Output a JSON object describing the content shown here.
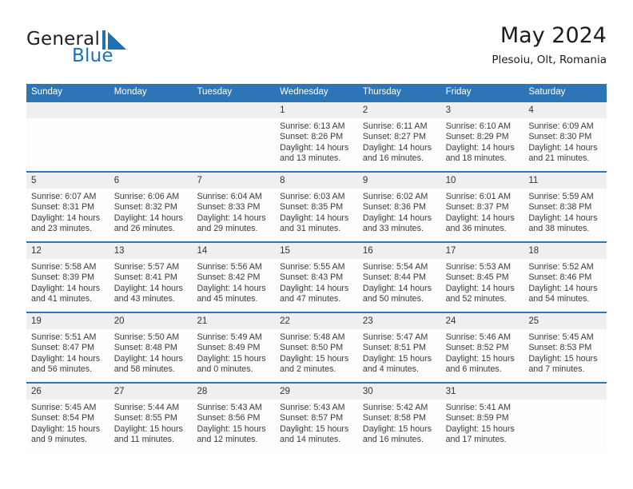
{
  "brand": {
    "word1": "General",
    "word2": "Blue",
    "mark_icon": "triangle-flag-icon",
    "color_text": "#231f20",
    "color_blue": "#1d71b8"
  },
  "header": {
    "title": "May 2024",
    "location": "Plesoiu, Olt, Romania"
  },
  "calendar": {
    "accent_color": "#2e75b6",
    "daynum_band_color": "#efefef",
    "weekday_headers": [
      "Sunday",
      "Monday",
      "Tuesday",
      "Wednesday",
      "Thursday",
      "Friday",
      "Saturday"
    ],
    "weeks": [
      [
        {
          "day": "",
          "lines": []
        },
        {
          "day": "",
          "lines": []
        },
        {
          "day": "",
          "lines": []
        },
        {
          "day": "1",
          "lines": [
            "Sunrise: 6:13 AM",
            "Sunset: 8:26 PM",
            "Daylight: 14 hours",
            "and 13 minutes."
          ]
        },
        {
          "day": "2",
          "lines": [
            "Sunrise: 6:11 AM",
            "Sunset: 8:27 PM",
            "Daylight: 14 hours",
            "and 16 minutes."
          ]
        },
        {
          "day": "3",
          "lines": [
            "Sunrise: 6:10 AM",
            "Sunset: 8:29 PM",
            "Daylight: 14 hours",
            "and 18 minutes."
          ]
        },
        {
          "day": "4",
          "lines": [
            "Sunrise: 6:09 AM",
            "Sunset: 8:30 PM",
            "Daylight: 14 hours",
            "and 21 minutes."
          ]
        }
      ],
      [
        {
          "day": "5",
          "lines": [
            "Sunrise: 6:07 AM",
            "Sunset: 8:31 PM",
            "Daylight: 14 hours",
            "and 23 minutes."
          ]
        },
        {
          "day": "6",
          "lines": [
            "Sunrise: 6:06 AM",
            "Sunset: 8:32 PM",
            "Daylight: 14 hours",
            "and 26 minutes."
          ]
        },
        {
          "day": "7",
          "lines": [
            "Sunrise: 6:04 AM",
            "Sunset: 8:33 PM",
            "Daylight: 14 hours",
            "and 29 minutes."
          ]
        },
        {
          "day": "8",
          "lines": [
            "Sunrise: 6:03 AM",
            "Sunset: 8:35 PM",
            "Daylight: 14 hours",
            "and 31 minutes."
          ]
        },
        {
          "day": "9",
          "lines": [
            "Sunrise: 6:02 AM",
            "Sunset: 8:36 PM",
            "Daylight: 14 hours",
            "and 33 minutes."
          ]
        },
        {
          "day": "10",
          "lines": [
            "Sunrise: 6:01 AM",
            "Sunset: 8:37 PM",
            "Daylight: 14 hours",
            "and 36 minutes."
          ]
        },
        {
          "day": "11",
          "lines": [
            "Sunrise: 5:59 AM",
            "Sunset: 8:38 PM",
            "Daylight: 14 hours",
            "and 38 minutes."
          ]
        }
      ],
      [
        {
          "day": "12",
          "lines": [
            "Sunrise: 5:58 AM",
            "Sunset: 8:39 PM",
            "Daylight: 14 hours",
            "and 41 minutes."
          ]
        },
        {
          "day": "13",
          "lines": [
            "Sunrise: 5:57 AM",
            "Sunset: 8:41 PM",
            "Daylight: 14 hours",
            "and 43 minutes."
          ]
        },
        {
          "day": "14",
          "lines": [
            "Sunrise: 5:56 AM",
            "Sunset: 8:42 PM",
            "Daylight: 14 hours",
            "and 45 minutes."
          ]
        },
        {
          "day": "15",
          "lines": [
            "Sunrise: 5:55 AM",
            "Sunset: 8:43 PM",
            "Daylight: 14 hours",
            "and 47 minutes."
          ]
        },
        {
          "day": "16",
          "lines": [
            "Sunrise: 5:54 AM",
            "Sunset: 8:44 PM",
            "Daylight: 14 hours",
            "and 50 minutes."
          ]
        },
        {
          "day": "17",
          "lines": [
            "Sunrise: 5:53 AM",
            "Sunset: 8:45 PM",
            "Daylight: 14 hours",
            "and 52 minutes."
          ]
        },
        {
          "day": "18",
          "lines": [
            "Sunrise: 5:52 AM",
            "Sunset: 8:46 PM",
            "Daylight: 14 hours",
            "and 54 minutes."
          ]
        }
      ],
      [
        {
          "day": "19",
          "lines": [
            "Sunrise: 5:51 AM",
            "Sunset: 8:47 PM",
            "Daylight: 14 hours",
            "and 56 minutes."
          ]
        },
        {
          "day": "20",
          "lines": [
            "Sunrise: 5:50 AM",
            "Sunset: 8:48 PM",
            "Daylight: 14 hours",
            "and 58 minutes."
          ]
        },
        {
          "day": "21",
          "lines": [
            "Sunrise: 5:49 AM",
            "Sunset: 8:49 PM",
            "Daylight: 15 hours",
            "and 0 minutes."
          ]
        },
        {
          "day": "22",
          "lines": [
            "Sunrise: 5:48 AM",
            "Sunset: 8:50 PM",
            "Daylight: 15 hours",
            "and 2 minutes."
          ]
        },
        {
          "day": "23",
          "lines": [
            "Sunrise: 5:47 AM",
            "Sunset: 8:51 PM",
            "Daylight: 15 hours",
            "and 4 minutes."
          ]
        },
        {
          "day": "24",
          "lines": [
            "Sunrise: 5:46 AM",
            "Sunset: 8:52 PM",
            "Daylight: 15 hours",
            "and 6 minutes."
          ]
        },
        {
          "day": "25",
          "lines": [
            "Sunrise: 5:45 AM",
            "Sunset: 8:53 PM",
            "Daylight: 15 hours",
            "and 7 minutes."
          ]
        }
      ],
      [
        {
          "day": "26",
          "lines": [
            "Sunrise: 5:45 AM",
            "Sunset: 8:54 PM",
            "Daylight: 15 hours",
            "and 9 minutes."
          ]
        },
        {
          "day": "27",
          "lines": [
            "Sunrise: 5:44 AM",
            "Sunset: 8:55 PM",
            "Daylight: 15 hours",
            "and 11 minutes."
          ]
        },
        {
          "day": "28",
          "lines": [
            "Sunrise: 5:43 AM",
            "Sunset: 8:56 PM",
            "Daylight: 15 hours",
            "and 12 minutes."
          ]
        },
        {
          "day": "29",
          "lines": [
            "Sunrise: 5:43 AM",
            "Sunset: 8:57 PM",
            "Daylight: 15 hours",
            "and 14 minutes."
          ]
        },
        {
          "day": "30",
          "lines": [
            "Sunrise: 5:42 AM",
            "Sunset: 8:58 PM",
            "Daylight: 15 hours",
            "and 16 minutes."
          ]
        },
        {
          "day": "31",
          "lines": [
            "Sunrise: 5:41 AM",
            "Sunset: 8:59 PM",
            "Daylight: 15 hours",
            "and 17 minutes."
          ]
        },
        {
          "day": "",
          "lines": []
        }
      ]
    ]
  }
}
